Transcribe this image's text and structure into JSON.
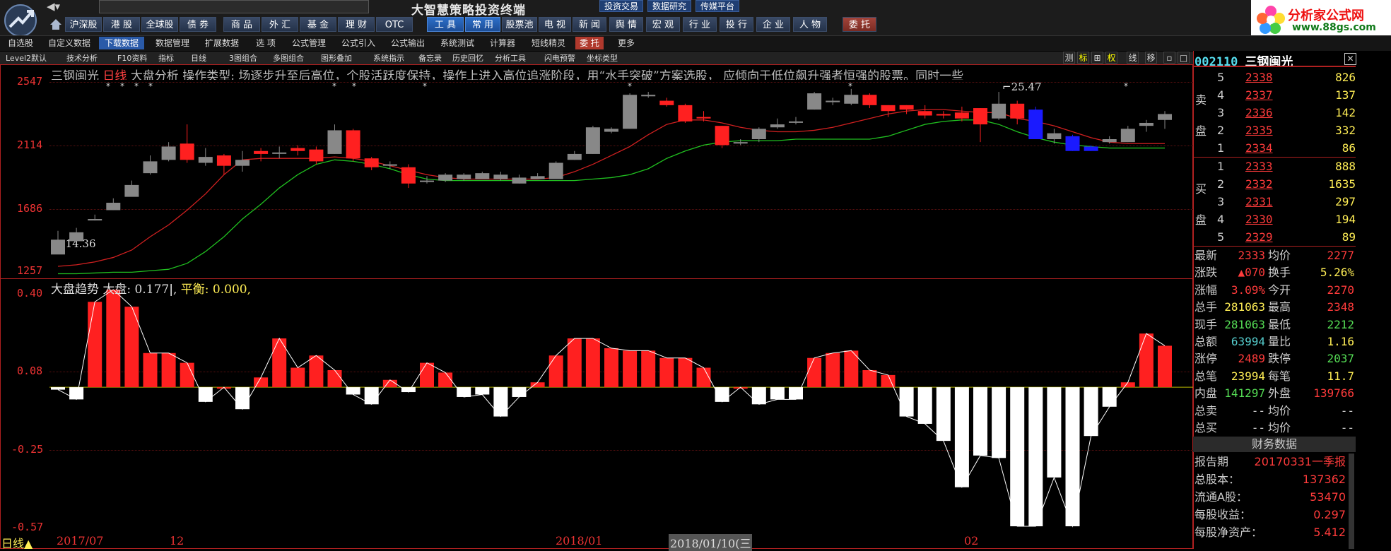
{
  "app": {
    "title": "大智慧策略投资终端",
    "nav_back_icon": "back-arrow-icon",
    "top_tags": [
      "投资交易",
      "数据研究",
      "传媒平台"
    ],
    "logo": {
      "line1": "分析家公式网",
      "line2": "www.88gs.com"
    }
  },
  "market_tabs": [
    "沪深股",
    "港 股",
    "全球股",
    "债 券",
    "商 品",
    "外 汇",
    "基 金",
    "理 财",
    "OTC"
  ],
  "function_tabs": [
    "工 具",
    "常 用",
    "股票池",
    "电 视",
    "新 闻",
    "舆 情",
    "宏 观",
    "行 业",
    "投 行",
    "企 业",
    "人 物",
    "委 托"
  ],
  "menu_items": [
    "自选股",
    "自定义数据",
    "下载数据",
    "数据管理",
    "扩展数据",
    "选 项",
    "公式管理",
    "公式引入",
    "公式输出",
    "系统测试",
    "计算器",
    "短线精灵",
    "委 托",
    "更多"
  ],
  "menu_selected": "下载数据",
  "toolbar_items": [
    "Level2默认",
    "技术分析",
    "F10资料",
    "指标",
    "日线",
    "3图组合",
    "多图组合",
    "图形叠加",
    "系统指示",
    "备忘录",
    "历史回忆",
    "分析工具",
    "闪电预警",
    "坐标类型"
  ],
  "toolbar_right": [
    "测",
    "标",
    "⊞",
    "权",
    "线",
    "移"
  ],
  "main_chart": {
    "stock_name": "三钢闽光",
    "period": "日线",
    "description_prefix": "大盘分析 操作类型:",
    "description": "场逐步升至后高位，个股活跃度保持，操作上进入高位追涨阶段，用“水手突破”方案选股， 应倾向于低位飙升强者恒强的股票。同时一些",
    "y_labels": [
      "2547",
      "2114",
      "1686",
      "1257"
    ],
    "low_marker": "14.36",
    "high_marker": "25.47"
  },
  "indicator": {
    "name": "大盘趋势",
    "dapan_label": "大盘:",
    "dapan_value": "0.177",
    "pingheng_label": "平衡:",
    "pingheng_value": "0.000,",
    "y_labels": [
      "0.40",
      "0.08",
      "-0.25",
      "-0.57"
    ]
  },
  "x_axis": {
    "period_label": "日线",
    "dates": [
      "2017/07",
      "12",
      "2018/01",
      "2018/01/10(三",
      "02"
    ]
  },
  "quote": {
    "code": "002110",
    "name": "三钢闽光",
    "sell_label": "卖 盘",
    "buy_label": "买 盘",
    "asks": [
      {
        "level": "5",
        "price": "2338",
        "vol": "826"
      },
      {
        "level": "4",
        "price": "2337",
        "vol": "137"
      },
      {
        "level": "3",
        "price": "2336",
        "vol": "142"
      },
      {
        "level": "2",
        "price": "2335",
        "vol": "332"
      },
      {
        "level": "1",
        "price": "2334",
        "vol": "86"
      }
    ],
    "bids": [
      {
        "level": "1",
        "price": "2333",
        "vol": "888"
      },
      {
        "level": "2",
        "price": "2332",
        "vol": "1635"
      },
      {
        "level": "3",
        "price": "2331",
        "vol": "297"
      },
      {
        "level": "4",
        "price": "2330",
        "vol": "194"
      },
      {
        "level": "5",
        "price": "2329",
        "vol": "89"
      }
    ],
    "stats": [
      {
        "l1": "最新",
        "v1": "2333",
        "l2": "均价",
        "v2": "2277",
        "c1": "#ff3b3b",
        "c2": "#ff3b3b"
      },
      {
        "l1": "涨跌",
        "v1": "▲070",
        "l2": "换手",
        "v2": "5.26%",
        "c1": "#ff3b3b",
        "c2": "#ffee55"
      },
      {
        "l1": "涨幅",
        "v1": "3.09%",
        "l2": "今开",
        "v2": "2270",
        "c1": "#ff3b3b",
        "c2": "#ff3b3b"
      },
      {
        "l1": "总手",
        "v1": "281063",
        "l2": "最高",
        "v2": "2348",
        "c1": "#ffee55",
        "c2": "#ff3b3b"
      },
      {
        "l1": "现手",
        "v1": "281063",
        "l2": "最低",
        "v2": "2212",
        "c1": "#55dd55",
        "c2": "#55dd55"
      },
      {
        "l1": "总额",
        "v1": "63994",
        "l2": "量比",
        "v2": "1.16",
        "c1": "#55cccc",
        "c2": "#ffee55"
      },
      {
        "l1": "涨停",
        "v1": "2489",
        "l2": "跌停",
        "v2": "2037",
        "c1": "#ff3b3b",
        "c2": "#55dd55"
      },
      {
        "l1": "总笔",
        "v1": "23994",
        "l2": "每笔",
        "v2": "11.7",
        "c1": "#ffee55",
        "c2": "#ffee55"
      },
      {
        "l1": "内盘",
        "v1": "141297",
        "l2": "外盘",
        "v2": "139766",
        "c1": "#55dd55",
        "c2": "#ff3b3b"
      },
      {
        "l1": "总卖",
        "v1": "--",
        "l2": "均价",
        "v2": "--",
        "c1": "#ccc",
        "c2": "#ccc"
      },
      {
        "l1": "总买",
        "v1": "--",
        "l2": "均价",
        "v2": "--",
        "c1": "#ccc",
        "c2": "#ccc"
      }
    ],
    "finance_header": "财务数据",
    "finance": [
      {
        "label": "报告期",
        "value": "20170331一季报"
      },
      {
        "label": "总股本：",
        "value": "137362"
      },
      {
        "label": "流通A股：",
        "value": "53470"
      },
      {
        "label": "每股收益：",
        "value": "0.297"
      },
      {
        "label": "每股净资产：",
        "value": "5.412"
      }
    ]
  },
  "colors": {
    "up": "#ff2020",
    "down_kline": "#888888",
    "blue": "#1a1aff",
    "bar_neg": "#ffffff",
    "ma_red": "#d02020",
    "ma_green": "#20c020"
  },
  "chart_data": [
    {
      "type": "candlestick",
      "title": "三钢闽光 日线",
      "ylim": [
        1257,
        2547
      ],
      "y_ticks": [
        2547,
        2114,
        1686,
        1257
      ],
      "candles": [
        {
          "o": 1480,
          "h": 1540,
          "l": 1440,
          "c": 1380
        },
        {
          "o": 1530,
          "h": 1560,
          "l": 1490,
          "c": 1470
        },
        {
          "o": 1620,
          "h": 1650,
          "l": 1610,
          "c": 1610
        },
        {
          "o": 1730,
          "h": 1760,
          "l": 1680,
          "c": 1680
        },
        {
          "o": 1850,
          "h": 1880,
          "l": 1780,
          "c": 1770
        },
        {
          "o": 2010,
          "h": 2050,
          "l": 1920,
          "c": 1930
        },
        {
          "o": 2110,
          "h": 2140,
          "l": 2010,
          "c": 2020
        },
        {
          "o": 2020,
          "h": 2260,
          "l": 2000,
          "c": 2130
        },
        {
          "o": 2040,
          "h": 2100,
          "l": 1980,
          "c": 2000
        },
        {
          "o": 1980,
          "h": 2060,
          "l": 1920,
          "c": 2050
        },
        {
          "o": 2020,
          "h": 2080,
          "l": 1940,
          "c": 1980
        },
        {
          "o": 2060,
          "h": 2100,
          "l": 2010,
          "c": 2080
        },
        {
          "o": 2070,
          "h": 2110,
          "l": 2030,
          "c": 2070
        },
        {
          "o": 2080,
          "h": 2120,
          "l": 2050,
          "c": 2100
        },
        {
          "o": 2010,
          "h": 2110,
          "l": 1990,
          "c": 2090
        },
        {
          "o": 2220,
          "h": 2260,
          "l": 2060,
          "c": 2060
        },
        {
          "o": 2030,
          "h": 2230,
          "l": 2010,
          "c": 2220
        },
        {
          "o": 1970,
          "h": 2040,
          "l": 1950,
          "c": 2030
        },
        {
          "o": 1990,
          "h": 2010,
          "l": 1960,
          "c": 1980
        },
        {
          "o": 1860,
          "h": 1990,
          "l": 1830,
          "c": 1970
        },
        {
          "o": 1880,
          "h": 1910,
          "l": 1860,
          "c": 1870
        },
        {
          "o": 1920,
          "h": 1930,
          "l": 1870,
          "c": 1880
        },
        {
          "o": 1920,
          "h": 1930,
          "l": 1880,
          "c": 1890
        },
        {
          "o": 1930,
          "h": 1940,
          "l": 1890,
          "c": 1890
        },
        {
          "o": 1920,
          "h": 1940,
          "l": 1880,
          "c": 1890
        },
        {
          "o": 1900,
          "h": 1920,
          "l": 1860,
          "c": 1860
        },
        {
          "o": 1910,
          "h": 1930,
          "l": 1890,
          "c": 1890
        },
        {
          "o": 2000,
          "h": 2010,
          "l": 1900,
          "c": 1890
        },
        {
          "o": 2060,
          "h": 2080,
          "l": 2020,
          "c": 2020
        },
        {
          "o": 2240,
          "h": 2250,
          "l": 2060,
          "c": 2060
        },
        {
          "o": 2230,
          "h": 2240,
          "l": 2200,
          "c": 2210
        },
        {
          "o": 2460,
          "h": 2470,
          "l": 2230,
          "c": 2230
        },
        {
          "o": 2460,
          "h": 2480,
          "l": 2440,
          "c": 2450
        },
        {
          "o": 2390,
          "h": 2440,
          "l": 2380,
          "c": 2420
        },
        {
          "o": 2280,
          "h": 2400,
          "l": 2270,
          "c": 2390
        },
        {
          "o": 2300,
          "h": 2350,
          "l": 2280,
          "c": 2310
        },
        {
          "o": 2120,
          "h": 2250,
          "l": 2100,
          "c": 2250
        },
        {
          "o": 2140,
          "h": 2160,
          "l": 2120,
          "c": 2140
        },
        {
          "o": 2230,
          "h": 2240,
          "l": 2140,
          "c": 2160
        },
        {
          "o": 2260,
          "h": 2300,
          "l": 2230,
          "c": 2240
        },
        {
          "o": 2280,
          "h": 2310,
          "l": 2260,
          "c": 2280
        },
        {
          "o": 2470,
          "h": 2480,
          "l": 2360,
          "c": 2360
        },
        {
          "o": 2420,
          "h": 2440,
          "l": 2390,
          "c": 2410
        },
        {
          "o": 2460,
          "h": 2500,
          "l": 2390,
          "c": 2400
        },
        {
          "o": 2390,
          "h": 2470,
          "l": 2370,
          "c": 2460
        },
        {
          "o": 2350,
          "h": 2390,
          "l": 2310,
          "c": 2390
        },
        {
          "o": 2360,
          "h": 2390,
          "l": 2330,
          "c": 2390
        },
        {
          "o": 2320,
          "h": 2390,
          "l": 2300,
          "c": 2350
        },
        {
          "o": 2320,
          "h": 2350,
          "l": 2300,
          "c": 2330
        },
        {
          "o": 2300,
          "h": 2380,
          "l": 2280,
          "c": 2340
        },
        {
          "o": 2260,
          "h": 2370,
          "l": 2140,
          "c": 2370
        },
        {
          "o": 2400,
          "h": 2480,
          "l": 2290,
          "c": 2300
        },
        {
          "o": 2300,
          "h": 2420,
          "l": 2260,
          "c": 2400
        },
        {
          "o": 2360,
          "h": 2380,
          "l": 2160,
          "c": 2160,
          "blue": true
        },
        {
          "o": 2200,
          "h": 2230,
          "l": 2130,
          "c": 2160
        },
        {
          "o": 2180,
          "h": 2190,
          "l": 2080,
          "c": 2080,
          "blue": true
        },
        {
          "o": 2110,
          "h": 2120,
          "l": 2080,
          "c": 2080,
          "blue": true
        },
        {
          "o": 2160,
          "h": 2180,
          "l": 2130,
          "c": 2140
        },
        {
          "o": 2230,
          "h": 2250,
          "l": 2140,
          "c": 2140
        },
        {
          "o": 2270,
          "h": 2290,
          "l": 2210,
          "c": 2250
        },
        {
          "o": 2330,
          "h": 2350,
          "l": 2230,
          "c": 2290
        }
      ],
      "ma_red": [
        1300,
        1310,
        1330,
        1360,
        1410,
        1500,
        1580,
        1680,
        1790,
        1920,
        2020,
        2030,
        2030,
        2030,
        2030,
        2040,
        2030,
        2010,
        1980,
        1950,
        1920,
        1900,
        1890,
        1890,
        1890,
        1890,
        1890,
        1900,
        1940,
        1990,
        2050,
        2110,
        2190,
        2260,
        2290,
        2290,
        2270,
        2240,
        2220,
        2210,
        2210,
        2220,
        2240,
        2270,
        2300,
        2330,
        2350,
        2360,
        2360,
        2350,
        2340,
        2340,
        2300,
        2280,
        2250,
        2210,
        2170,
        2140,
        2130,
        2130,
        2130
      ],
      "ma_green": [
        1250,
        1250,
        1255,
        1260,
        1260,
        1270,
        1280,
        1320,
        1400,
        1500,
        1620,
        1720,
        1830,
        1920,
        1990,
        2020,
        2010,
        1990,
        1960,
        1920,
        1890,
        1880,
        1880,
        1880,
        1880,
        1880,
        1880,
        1880,
        1880,
        1890,
        1900,
        1920,
        1960,
        2030,
        2080,
        2120,
        2140,
        2150,
        2150,
        2150,
        2160,
        2160,
        2160,
        2160,
        2160,
        2180,
        2220,
        2260,
        2280,
        2290,
        2290,
        2260,
        2210,
        2170,
        2140,
        2120,
        2110,
        2100,
        2100,
        2100,
        2100
      ]
    },
    {
      "type": "bar",
      "title": "大盘趋势",
      "ylim": [
        -0.57,
        0.4
      ],
      "y_ticks": [
        0.4,
        0.08,
        -0.25,
        -0.57
      ],
      "values": [
        -0.01,
        -0.05,
        0.35,
        0.4,
        0.33,
        0.14,
        0.14,
        0.1,
        -0.06,
        0,
        -0.09,
        0.04,
        0.2,
        0.08,
        0.13,
        0.07,
        -0.03,
        -0.07,
        0.03,
        -0.02,
        0.1,
        0.06,
        -0.04,
        -0.03,
        -0.12,
        -0.04,
        0.02,
        0.13,
        0.2,
        0.2,
        0.16,
        0.15,
        0.15,
        0.12,
        0.12,
        0.08,
        -0.06,
        0,
        -0.07,
        -0.05,
        -0.05,
        0.12,
        0.14,
        0.15,
        0.07,
        0.05,
        -0.12,
        -0.15,
        -0.22,
        -0.41,
        -0.28,
        -0.29,
        -0.57,
        -0.57,
        -0.37,
        -0.57,
        -0.2,
        -0.08,
        0.02,
        0.22,
        0.17
      ]
    }
  ]
}
